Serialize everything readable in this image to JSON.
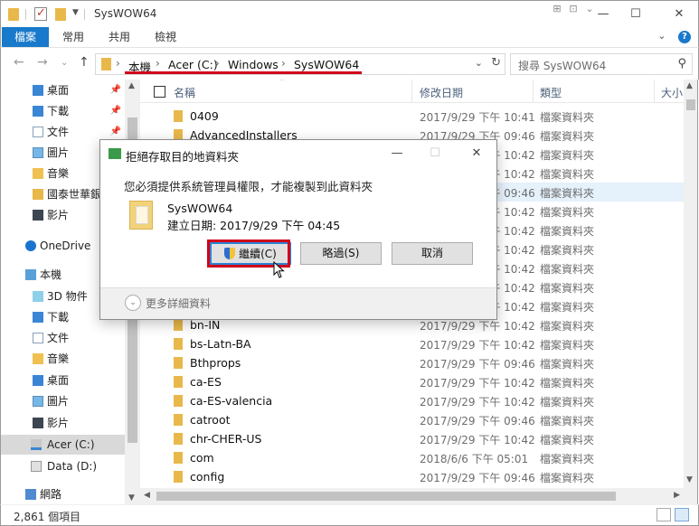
{
  "window": {
    "title": "SysWOW64",
    "qa_arrow": "▼",
    "ghost_ctrls": [
      "⊞",
      "⊡",
      "⌄"
    ],
    "minimize": "—",
    "maximize": "☐",
    "close": "✕"
  },
  "ribbon": {
    "file_tab": "檔案",
    "tabs": [
      "常用",
      "共用",
      "檢視"
    ],
    "collapse": "⌄",
    "help": "?"
  },
  "address": {
    "back": "←",
    "forward": "→",
    "recent": "⌄",
    "up": "↑",
    "crumbs": [
      "本機",
      "Acer (C:)",
      "Windows",
      "SysWOW64"
    ],
    "separator": "›",
    "dropdown": "⌄",
    "refresh": "↻",
    "search_placeholder": "搜尋 SysWOW64",
    "search_glyph": "⚲"
  },
  "nav": {
    "items": [
      {
        "label": "桌面",
        "icon": "desktop-folder-icon",
        "pin": "📌"
      },
      {
        "label": "下載",
        "icon": "downloads-folder-icon",
        "pin": "📌"
      },
      {
        "label": "文件",
        "icon": "documents-folder-icon",
        "pin": "📌"
      },
      {
        "label": "圖片",
        "icon": "pictures-folder-icon",
        "pin": "📌"
      },
      {
        "label": "音樂",
        "icon": "music-folder-icon",
        "pin": ""
      },
      {
        "label": "國泰世華銀",
        "icon": "folder-icon",
        "pin": ""
      },
      {
        "label": "影片",
        "icon": "videos-folder-icon",
        "pin": ""
      },
      {
        "label": "OneDrive",
        "icon": "onedrive-icon",
        "pin": ""
      },
      {
        "label": "本機",
        "icon": "this-pc-icon",
        "pin": ""
      },
      {
        "label": "3D 物件",
        "icon": "3d-objects-icon",
        "pin": ""
      },
      {
        "label": "下載",
        "icon": "downloads-folder-icon",
        "pin": ""
      },
      {
        "label": "文件",
        "icon": "documents-folder-icon",
        "pin": ""
      },
      {
        "label": "音樂",
        "icon": "music-folder-icon",
        "pin": ""
      },
      {
        "label": "桌面",
        "icon": "desktop-folder-icon",
        "pin": ""
      },
      {
        "label": "圖片",
        "icon": "pictures-folder-icon",
        "pin": ""
      },
      {
        "label": "影片",
        "icon": "videos-folder-icon",
        "pin": ""
      },
      {
        "label": "Acer (C:)",
        "icon": "drive-c-icon",
        "pin": ""
      },
      {
        "label": "Data (D:)",
        "icon": "drive-d-icon",
        "pin": ""
      },
      {
        "label": "網路",
        "icon": "network-icon",
        "pin": ""
      }
    ],
    "selected_index": 16,
    "scroll_up": "▲",
    "scroll_down": "▼"
  },
  "list": {
    "columns": [
      "名稱",
      "修改日期",
      "類型",
      "大小"
    ],
    "sort_glyph": "⌃",
    "rows": [
      {
        "name": "0409",
        "date": "2017/9/29 下午 10:41",
        "type": "檔案資料夾"
      },
      {
        "name": "AdvancedInstallers",
        "date": "2017/9/29 下午 09:46",
        "type": "檔案資料夾"
      },
      {
        "name": "",
        "date": "2017/9/29 下午 10:42",
        "type": "檔案資料夾"
      },
      {
        "name": "",
        "date": "2017/9/29 下午 10:42",
        "type": "檔案資料夾"
      },
      {
        "name": "",
        "date": "2017/9/29 下午 09:46",
        "type": "檔案資料夾"
      },
      {
        "name": "",
        "date": "2017/9/29 下午 10:42",
        "type": "檔案資料夾"
      },
      {
        "name": "",
        "date": "2017/9/29 下午 10:42",
        "type": "檔案資料夾"
      },
      {
        "name": "",
        "date": "2017/9/29 下午 10:42",
        "type": "檔案資料夾"
      },
      {
        "name": "",
        "date": "2017/9/29 下午 10:42",
        "type": "檔案資料夾"
      },
      {
        "name": "",
        "date": "2017/9/29 下午 10:42",
        "type": "檔案資料夾"
      },
      {
        "name": "",
        "date": "2017/9/29 下午 10:42",
        "type": "檔案資料夾"
      },
      {
        "name": "bn-IN",
        "date": "2017/9/29 下午 10:42",
        "type": "檔案資料夾"
      },
      {
        "name": "bs-Latn-BA",
        "date": "2017/9/29 下午 10:42",
        "type": "檔案資料夾"
      },
      {
        "name": "Bthprops",
        "date": "2017/9/29 下午 09:46",
        "type": "檔案資料夾"
      },
      {
        "name": "ca-ES",
        "date": "2017/9/29 下午 10:42",
        "type": "檔案資料夾"
      },
      {
        "name": "ca-ES-valencia",
        "date": "2017/9/29 下午 10:42",
        "type": "檔案資料夾"
      },
      {
        "name": "catroot",
        "date": "2017/9/29 下午 09:46",
        "type": "檔案資料夾"
      },
      {
        "name": "chr-CHER-US",
        "date": "2017/9/29 下午 10:42",
        "type": "檔案資料夾"
      },
      {
        "name": "com",
        "date": "2018/6/6 下午 05:01",
        "type": "檔案資料夾"
      },
      {
        "name": "config",
        "date": "2017/9/29 下午 09:46",
        "type": "檔案資料夾"
      }
    ],
    "highlighted_index": 4,
    "scroll_up": "▲",
    "scroll_down": "▼",
    "scroll_left": "◀",
    "scroll_right": "▶"
  },
  "status": {
    "item_count": "2,861 個項目"
  },
  "dialog": {
    "title": "拒絕存取目的地資料夾",
    "message": "您必須提供系統管理員權限，才能複製到此資料夾",
    "folder_name": "SysWOW64",
    "created": "建立日期: 2017/9/29 下午 04:45",
    "continue_label": "繼續(C)",
    "skip_label": "略過(S)",
    "cancel_label": "取消",
    "more_details": "更多詳細資料",
    "chevron": "⌄",
    "minimize": "—",
    "maximize": "☐",
    "close": "✕"
  },
  "colors": {
    "accent": "#1979ca",
    "annotation_red": "#d0021b",
    "folder": "#e8b84a"
  }
}
